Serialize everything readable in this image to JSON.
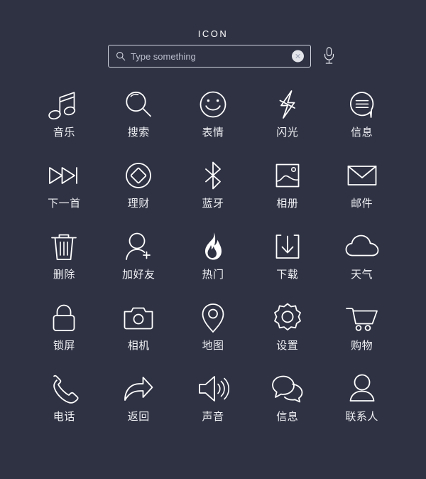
{
  "header": {
    "title": "ICON"
  },
  "search": {
    "placeholder": "Type something",
    "value": "",
    "search_icon": "search-icon",
    "clear_icon": "clear-circle-icon",
    "mic_icon": "microphone-icon"
  },
  "colors": {
    "background": "#2f3243",
    "icon_stroke": "#ffffff",
    "label_text": "#f0f1f5",
    "placeholder_text": "#b9bdcb",
    "clear_button_fill": "#e2e4ea",
    "search_border": "#cfd2dd"
  },
  "icons": [
    {
      "label": "音乐",
      "icon": "music-note-icon"
    },
    {
      "label": "搜索",
      "icon": "magnifier-icon"
    },
    {
      "label": "表情",
      "icon": "smiley-face-icon"
    },
    {
      "label": "闪光",
      "icon": "lightning-bolt-icon"
    },
    {
      "label": "信息",
      "icon": "message-bubble-lines-icon"
    },
    {
      "label": "下一首",
      "icon": "next-track-icon"
    },
    {
      "label": "理财",
      "icon": "diamond-in-circle-icon"
    },
    {
      "label": "蓝牙",
      "icon": "bluetooth-icon"
    },
    {
      "label": "相册",
      "icon": "photo-album-icon"
    },
    {
      "label": "邮件",
      "icon": "envelope-icon"
    },
    {
      "label": "删除",
      "icon": "trash-can-icon"
    },
    {
      "label": "加好友",
      "icon": "add-friend-icon"
    },
    {
      "label": "热门",
      "icon": "flame-icon"
    },
    {
      "label": "下载",
      "icon": "download-icon"
    },
    {
      "label": "天气",
      "icon": "cloud-icon"
    },
    {
      "label": "锁屏",
      "icon": "lock-icon"
    },
    {
      "label": "相机",
      "icon": "camera-icon"
    },
    {
      "label": "地图",
      "icon": "map-pin-icon"
    },
    {
      "label": "设置",
      "icon": "gear-icon"
    },
    {
      "label": "购物",
      "icon": "shopping-cart-icon"
    },
    {
      "label": "电话",
      "icon": "phone-handset-icon"
    },
    {
      "label": "返回",
      "icon": "return-arrow-icon"
    },
    {
      "label": "声音",
      "icon": "speaker-volume-icon"
    },
    {
      "label": "信息",
      "icon": "chat-bubbles-icon"
    },
    {
      "label": "联系人",
      "icon": "contact-person-icon"
    }
  ]
}
